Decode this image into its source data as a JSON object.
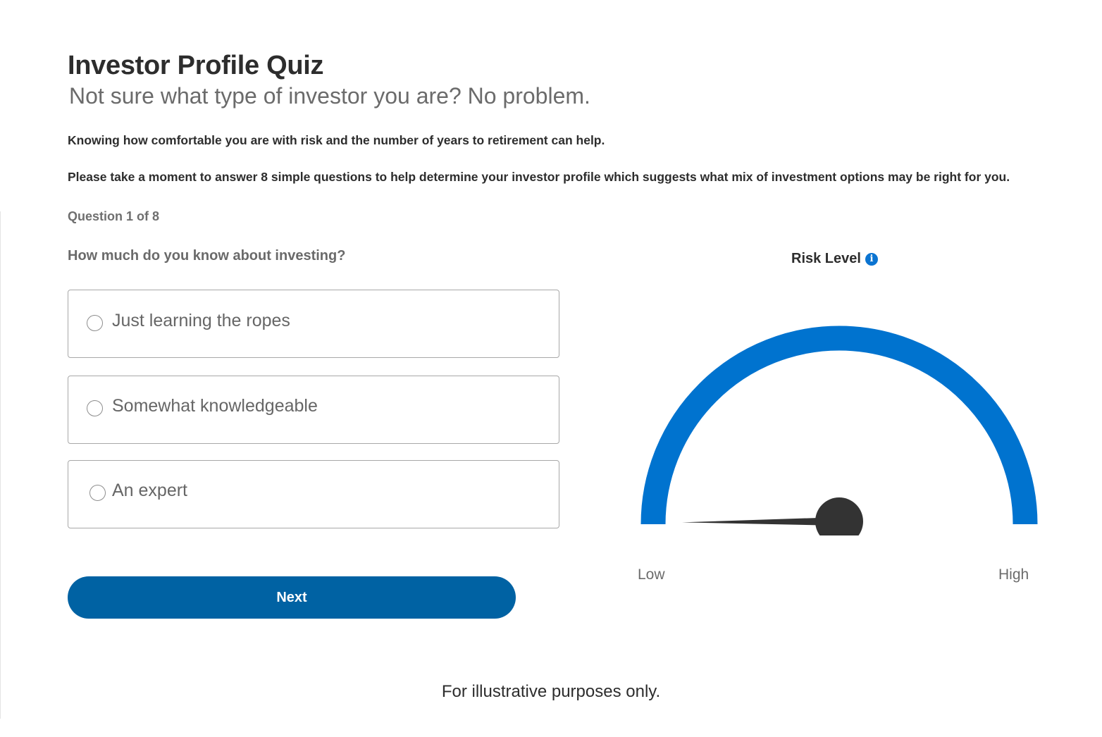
{
  "header": {
    "title": "Investor Profile Quiz",
    "subtitle": "Not sure what type of investor you are? No problem."
  },
  "intro": {
    "line1": "Knowing how comfortable you are with risk and the number of years to retirement can help.",
    "line2": "Please take a moment to answer 8 simple questions to help determine your investor profile which suggests what mix of investment options may be right for you."
  },
  "quiz": {
    "progress": "Question 1 of 8",
    "question": "How much do you know about investing?",
    "options": [
      {
        "label": "Just learning the ropes",
        "selected": false
      },
      {
        "label": "Somewhat knowledgeable",
        "selected": false
      },
      {
        "label": "An expert",
        "selected": false
      }
    ],
    "next_label": "Next"
  },
  "risk": {
    "title": "Risk Level",
    "info_icon": "info-icon",
    "low_label": "Low",
    "high_label": "High",
    "needle_level": 0,
    "arc_color": "#0073cf",
    "needle_color": "#333333"
  },
  "footer": {
    "disclaimer": "For illustrative purposes only."
  },
  "colors": {
    "button": "#0062a3",
    "accent": "#0073cf"
  }
}
